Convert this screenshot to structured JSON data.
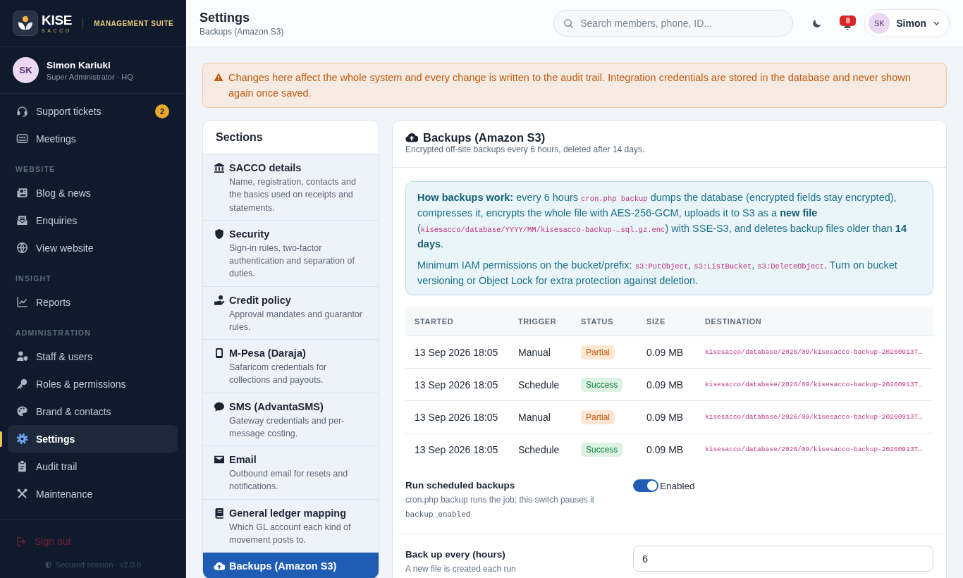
{
  "brand": {
    "name": "KISE",
    "tagline": "SACCO",
    "suite": "MANAGEMENT SUITE"
  },
  "profile": {
    "initials": "SK",
    "name": "Simon Kariuki",
    "role": "Super Administrator · HQ"
  },
  "nav": [
    {
      "items": [
        {
          "label": "Support tickets",
          "badge": "2",
          "selected": false
        },
        {
          "label": "Meetings",
          "selected": false
        }
      ]
    },
    {
      "heading": "WEBSITE",
      "items": [
        {
          "label": "Blog & news",
          "selected": false
        },
        {
          "label": "Enquiries",
          "selected": false
        },
        {
          "label": "View website",
          "selected": false
        }
      ]
    },
    {
      "heading": "INSIGHT",
      "items": [
        {
          "label": "Reports",
          "selected": false
        }
      ]
    },
    {
      "heading": "ADMINISTRATION",
      "items": [
        {
          "label": "Staff & users",
          "selected": false
        },
        {
          "label": "Roles & permissions",
          "selected": false
        },
        {
          "label": "Brand & contacts",
          "selected": false
        },
        {
          "label": "Settings",
          "selected": true
        },
        {
          "label": "Audit trail",
          "selected": false
        },
        {
          "label": "Maintenance",
          "selected": false
        }
      ]
    }
  ],
  "sign_out": "Sign out",
  "session": "Secured session · v2.0.0",
  "header": {
    "title": "Settings",
    "subtitle": "Backups (Amazon S3)",
    "search": {
      "placeholder": "Search members, phone, ID..."
    },
    "notifications": "8",
    "user": {
      "initials": "SK",
      "name": "Simon"
    }
  },
  "alert": "Changes here affect the whole system and every change is written to the audit trail. Integration credentials are stored in the database and never shown again once saved.",
  "sections": {
    "title": "Sections",
    "items": [
      {
        "title": "SACCO details",
        "description": "Name, registration, contacts and the basics used on receipts and statements.",
        "selected": false
      },
      {
        "title": "Security",
        "description": "Sign-in rules, two-factor authentication and separation of duties.",
        "selected": false
      },
      {
        "title": "Credit policy",
        "description": "Approval mandates and guarantor rules.",
        "selected": false
      },
      {
        "title": "M-Pesa (Daraja)",
        "description": "Safaricom credentials for collections and payouts.",
        "selected": false
      },
      {
        "title": "SMS (AdvantaSMS)",
        "description": "Gateway credentials and per-message costing.",
        "selected": false
      },
      {
        "title": "Email",
        "description": "Outbound email for resets and notifications.",
        "selected": false
      },
      {
        "title": "General ledger mapping",
        "description": "Which GL account each kind of movement posts to.",
        "selected": false
      },
      {
        "title": "Backups (Amazon S3)",
        "selected": true
      }
    ]
  },
  "panel": {
    "title": "Backups (Amazon S3)",
    "subtitle": "Encrypted off-site backups every 6 hours, deleted after 14 days.",
    "info": [
      [
        {
          "kind": "text",
          "text": "**How backups work:** every 6 hours "
        },
        {
          "kind": "code",
          "text": "cron.php backup"
        },
        {
          "kind": "text",
          "text": " dumps the database (encrypted fields stay encrypted), compresses it, encrypts the whole file with AES-256-GCM, uploads it to S3 as a **new file** ("
        },
        {
          "kind": "code",
          "text": "kisesacco/database/YYYY/MM/kisesacco-backup-…sql.gz.enc"
        },
        {
          "kind": "text",
          "text": ") with SSE-S3, and deletes backup files older than **14 days**."
        }
      ],
      [
        {
          "kind": "text",
          "text": "Minimum IAM permissions on the bucket/prefix: "
        },
        {
          "kind": "code",
          "text": "s3:PutObject"
        },
        {
          "kind": "text",
          "text": ", "
        },
        {
          "kind": "code",
          "text": "s3:ListBucket"
        },
        {
          "kind": "text",
          "text": ", "
        },
        {
          "kind": "code",
          "text": "s3:DeleteObject"
        },
        {
          "kind": "text",
          "text": ". Turn on bucket versioning or Object Lock for extra protection against deletion."
        }
      ]
    ],
    "table": {
      "columns": [
        "STARTED",
        "TRIGGER",
        "STATUS",
        "SIZE",
        "DESTINATION"
      ],
      "rows": [
        {
          "started": "13 Sep 2026 18:05",
          "trigger": "Manual",
          "status": {
            "label": "Partial",
            "kind": "warning"
          },
          "size": "0.09 MB",
          "destination": "kisesacco/database/2026/09/kisesacco-backup-20260913T…"
        },
        {
          "started": "13 Sep 2026 18:05",
          "trigger": "Schedule",
          "status": {
            "label": "Success",
            "kind": "success"
          },
          "size": "0.09 MB",
          "destination": "kisesacco/database/2026/09/kisesacco-backup-20260913T…"
        },
        {
          "started": "13 Sep 2026 18:05",
          "trigger": "Manual",
          "status": {
            "label": "Partial",
            "kind": "warning"
          },
          "size": "0.09 MB",
          "destination": "kisesacco/database/2026/09/kisesacco-backup-20260913T…"
        },
        {
          "started": "13 Sep 2026 18:05",
          "trigger": "Schedule",
          "status": {
            "label": "Success",
            "kind": "success"
          },
          "size": "0.09 MB",
          "destination": "kisesacco/database/2026/09/kisesacco-backup-20260913T…"
        }
      ]
    },
    "settings": [
      {
        "kind": "toggle",
        "label": "Run scheduled backups",
        "help": "cron.php backup runs the job; this switch pauses it",
        "key": "backup_enabled",
        "on": true,
        "state_label": "Enabled"
      },
      {
        "kind": "number",
        "label": "Back up every (hours)",
        "help": "A new file is created each run",
        "value": "6"
      }
    ]
  }
}
